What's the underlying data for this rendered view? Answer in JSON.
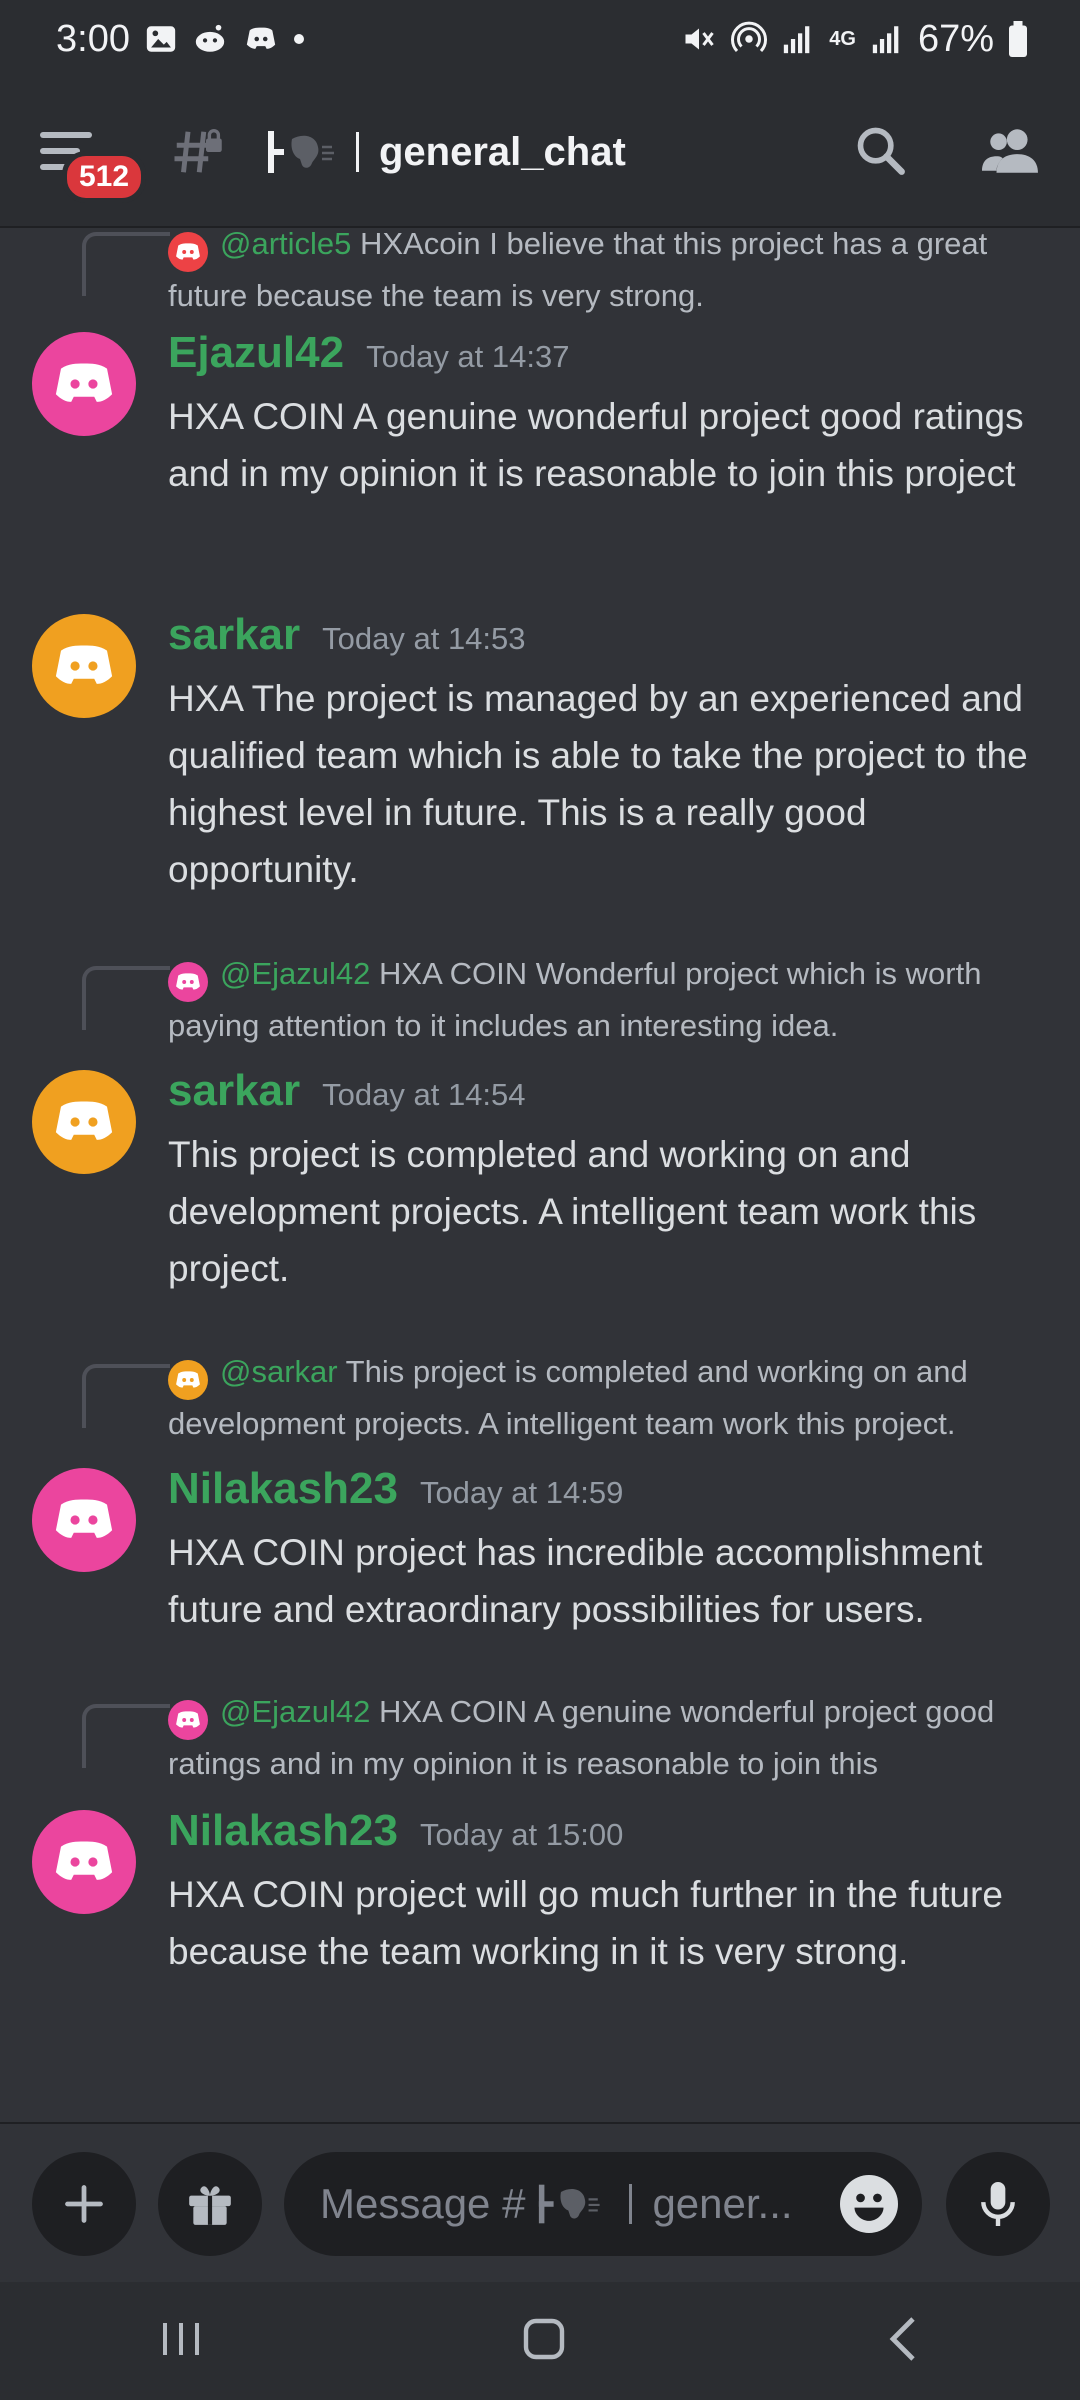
{
  "status_bar": {
    "time": "3:00",
    "battery": "67%"
  },
  "header": {
    "badge_count": "512",
    "channel_name": "general_chat"
  },
  "messages": [
    {
      "reply": {
        "mention": "@article5",
        "text": "HXAcoin I believe that this project has a great future because the team is very strong."
      }
    },
    {
      "author": "Ejazul42",
      "timestamp": "Today at 14:37",
      "content": "HXA COIN A genuine wonderful  project good ratings and in my opinion it is reasonable to join this project"
    },
    {
      "author": "sarkar",
      "timestamp": "Today at 14:53",
      "content": "HXA The project is managed by an experienced and qualified team which is able to take the project to the highest level in future. This is a really good opportunity."
    },
    {
      "reply": {
        "mention": "@Ejazul42",
        "text": "HXA COIN Wonderful project which is worth paying attention to it includes an interesting idea."
      },
      "author": "sarkar",
      "timestamp": "Today at 14:54",
      "content": "This project is completed and working on and development projects. A intelligent team work this project."
    },
    {
      "reply": {
        "mention": "@sarkar",
        "text": "This project is completed and working on and development projects. A intelligent team work this project."
      },
      "author": "Nilakash23",
      "timestamp": "Today at 14:59",
      "content": "HXA COIN project has incredible accomplishment future and extraordinary possibilities for users."
    },
    {
      "reply": {
        "mention": "@Ejazul42",
        "text": "HXA COIN A genuine wonderful  project good ratings and in my opinion it is reasonable to join this"
      },
      "author": "Nilakash23",
      "timestamp": "Today at 15:00",
      "content": "HXA COIN project will go much further in the future because the team working in it is very strong."
    }
  ],
  "composer": {
    "placeholder_prefix": "Message #",
    "placeholder_suffix": "gener..."
  },
  "colors": {
    "accent_green": "#3ba55d",
    "avatar_pink": "#eb459e",
    "avatar_orange": "#f0a020",
    "badge_red": "#da373c"
  },
  "icons": [
    "hamburger-icon",
    "hashtag-lock-icon",
    "search-icon",
    "members-icon",
    "plus-icon",
    "gift-icon",
    "emoji-icon",
    "mic-icon",
    "recents-icon",
    "home-icon",
    "back-icon"
  ]
}
